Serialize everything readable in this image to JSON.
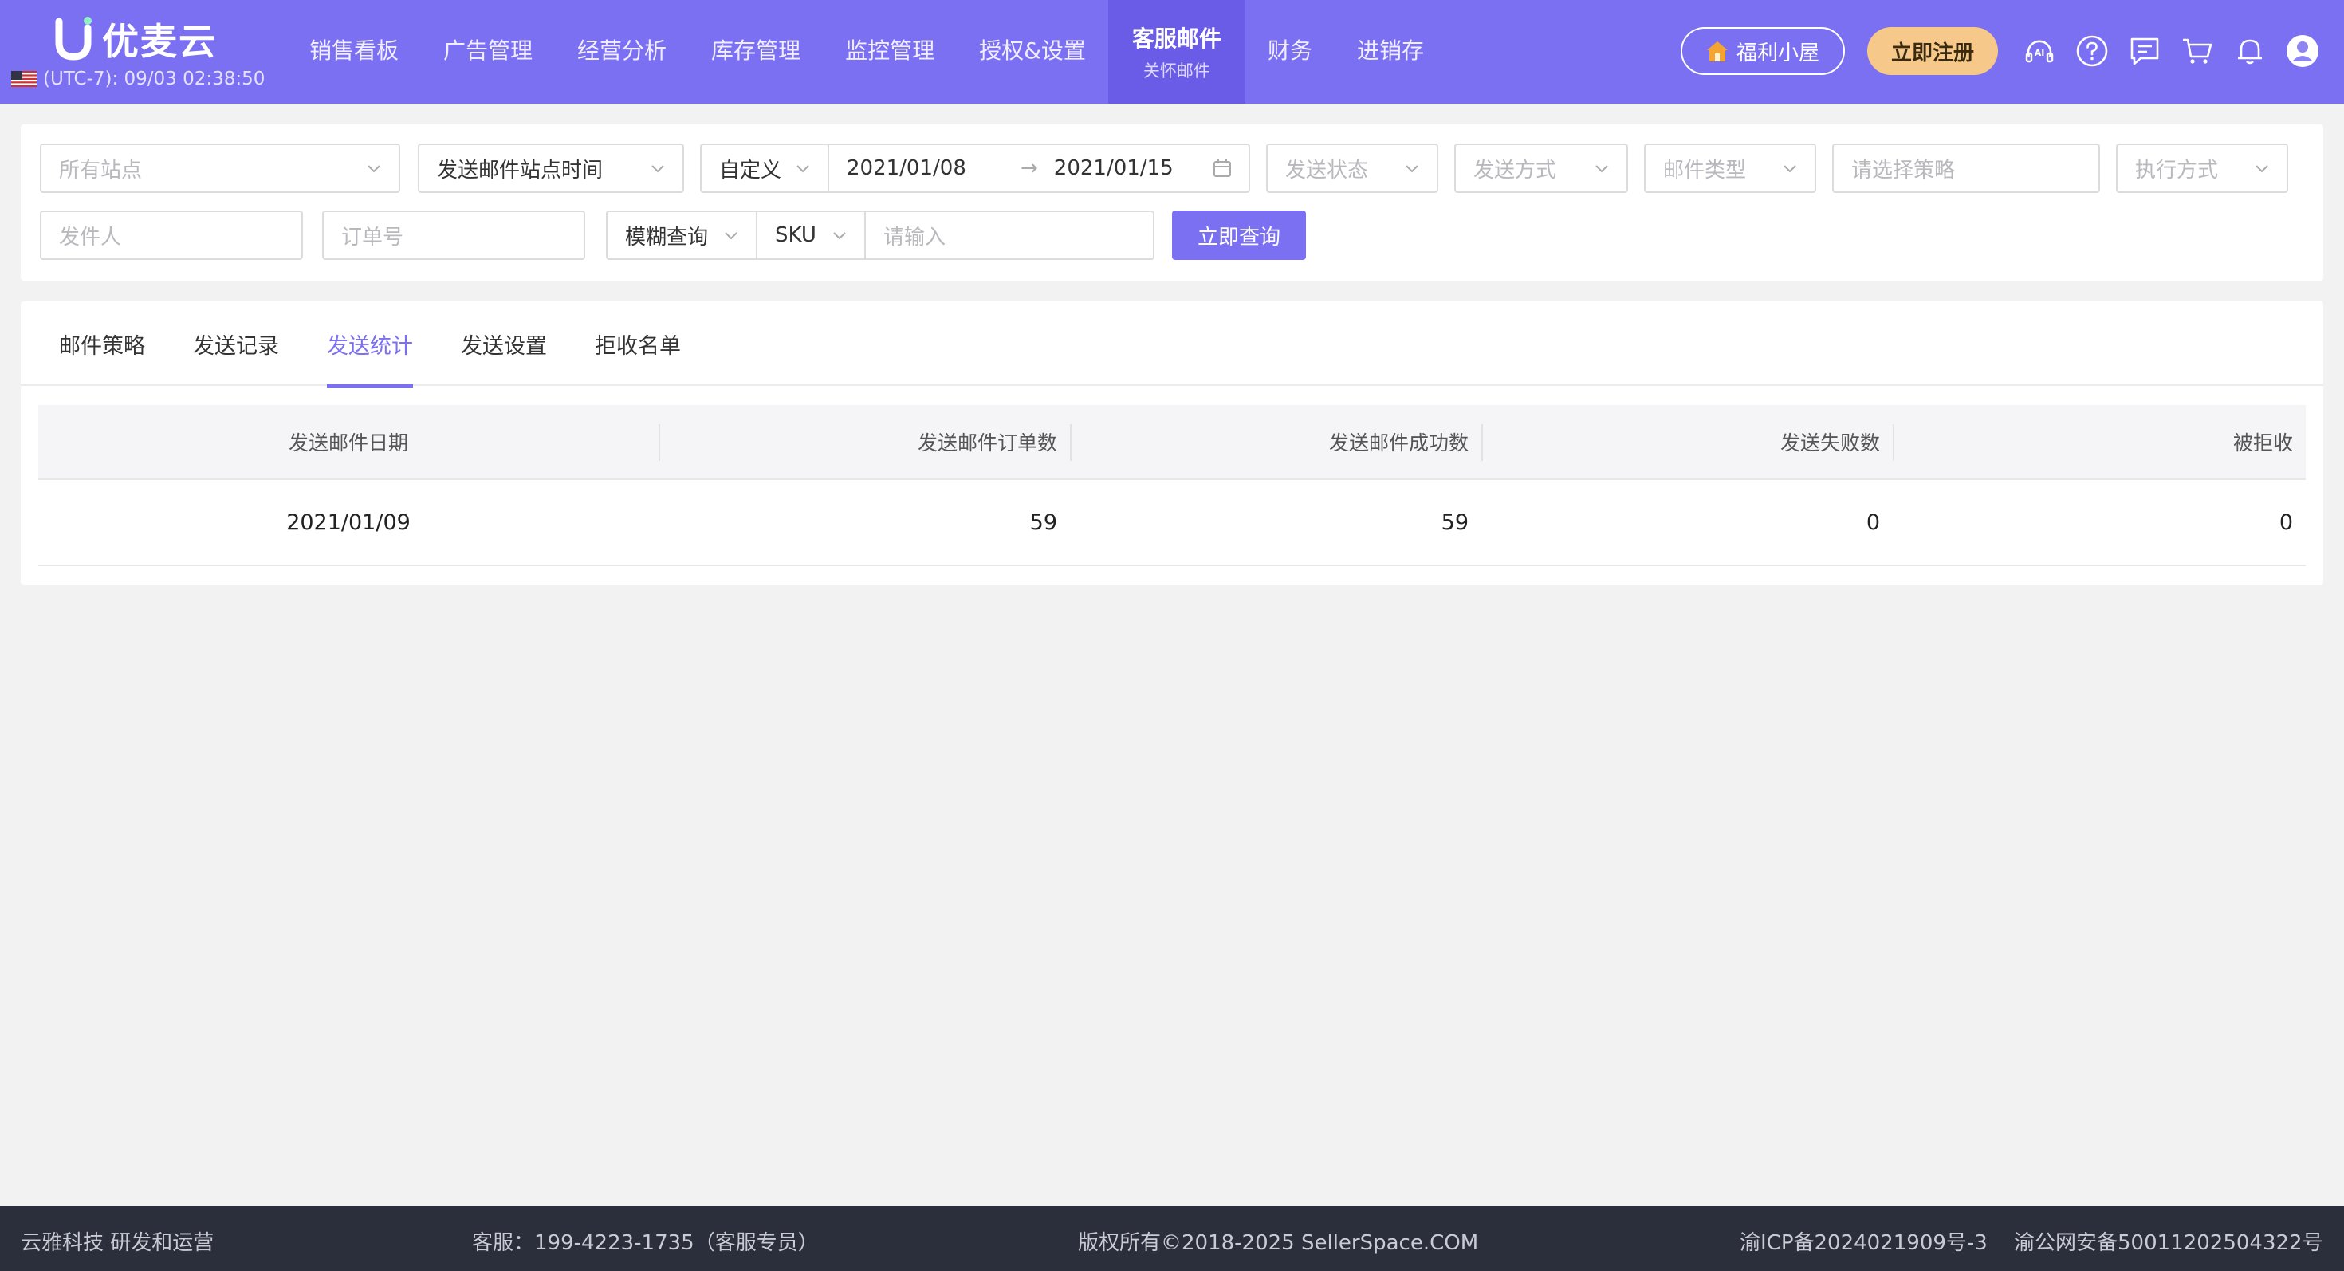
{
  "header": {
    "logo_text": "优麦云",
    "timezone": "(UTC-7): 09/03 02:38:50",
    "nav": [
      {
        "label": "销售看板"
      },
      {
        "label": "广告管理"
      },
      {
        "label": "经营分析"
      },
      {
        "label": "库存管理"
      },
      {
        "label": "监控管理"
      },
      {
        "label": "授权&设置"
      },
      {
        "label": "客服邮件",
        "sub": "关怀邮件",
        "active": true
      },
      {
        "label": "财务"
      },
      {
        "label": "进销存"
      }
    ],
    "welfare_label": "福利小屋",
    "register_label": "立即注册",
    "icons": [
      "ai-icon",
      "help-icon",
      "message-icon",
      "cart-icon",
      "bell-icon",
      "avatar-icon"
    ]
  },
  "filters": {
    "site_placeholder": "所有站点",
    "time_type_value": "发送邮件站点时间",
    "range_type_value": "自定义",
    "date_start": "2021/01/08",
    "date_end": "2021/01/15",
    "send_status_placeholder": "发送状态",
    "send_method_placeholder": "发送方式",
    "mail_type_placeholder": "邮件类型",
    "strategy_placeholder": "请选择策略",
    "exec_method_placeholder": "执行方式",
    "sender_placeholder": "发件人",
    "order_placeholder": "订单号",
    "match_mode_value": "模糊查询",
    "search_field_value": "SKU",
    "keyword_placeholder": "请输入",
    "query_button": "立即查询"
  },
  "tabs": [
    {
      "label": "邮件策略"
    },
    {
      "label": "发送记录"
    },
    {
      "label": "发送统计",
      "active": true
    },
    {
      "label": "发送设置"
    },
    {
      "label": "拒收名单"
    }
  ],
  "table": {
    "columns": [
      "发送邮件日期",
      "发送邮件订单数",
      "发送邮件成功数",
      "发送失败数",
      "被拒收"
    ],
    "rows": [
      [
        "2021/01/09",
        "59",
        "59",
        "0",
        "0"
      ]
    ]
  },
  "footer": {
    "company": "云雅科技 研发和运营",
    "service": "客服：199-4223-1735（客服专员）",
    "copyright": "版权所有©2018-2025 SellerSpace.COM",
    "icp": "渝ICP备2024021909号-3",
    "police": "渝公网安备50011202504322号"
  },
  "colors": {
    "brand": "#7b6ff2",
    "nav_active": "#6a5ce6",
    "register": "#f6c98b",
    "footer": "#2b2e3b"
  }
}
